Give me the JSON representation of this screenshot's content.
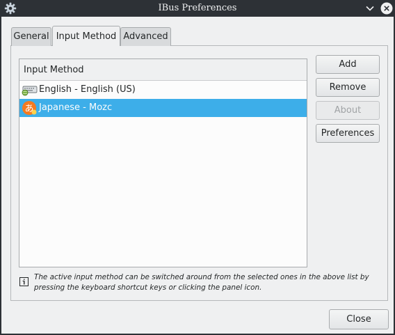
{
  "window": {
    "title": "IBus Preferences",
    "icon": "gear-icon"
  },
  "tabs": [
    {
      "label": "General",
      "active": false
    },
    {
      "label": "Input Method",
      "active": true
    },
    {
      "label": "Advanced",
      "active": false
    }
  ],
  "input_method_list": {
    "header": "Input Method",
    "items": [
      {
        "label": "English - English (US)",
        "icon": "keyboard-icon",
        "selected": false
      },
      {
        "label": "Japanese - Mozc",
        "icon": "mozc-icon",
        "icon_glyph": "あ",
        "selected": true
      }
    ]
  },
  "buttons": {
    "add": "Add",
    "remove": "Remove",
    "about": "About",
    "preferences": "Preferences",
    "close": "Close"
  },
  "hint": {
    "text": "The active input method can be switched around from the selected ones in the above list by pressing the keyboard shortcut keys or clicking the panel icon."
  },
  "colors": {
    "selection": "#3daee9",
    "titlebar": "#2d3136",
    "mozc_orange": "#f47a20"
  }
}
